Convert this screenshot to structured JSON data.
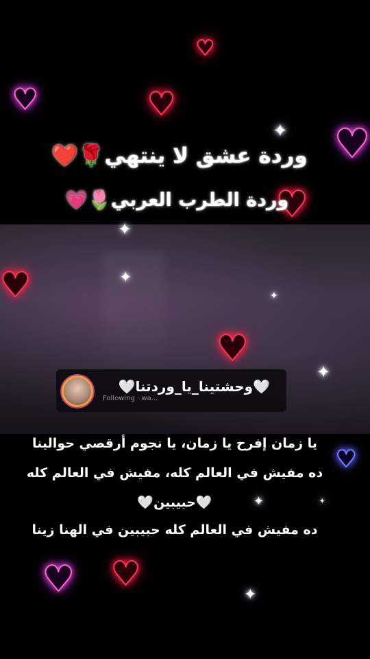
{
  "title": {
    "line1_text": "وردة عشق لا ينتهي",
    "line1_emojis": "🌹❤️",
    "line2_text": "وردة الطرب العربي",
    "line2_emojis": "🌷💗"
  },
  "comment": {
    "meta": "Following · wa...",
    "text": "🤍وحشتينا_يا_وردتنا🤍"
  },
  "lyrics": {
    "line1": "يا زمان إفرح يا زمان، يا نجوم أرقصي حوالينا",
    "line2": "ده مفيش في العالم كله، مفيش في العالم كله",
    "line3": "🤍حبيبين🤍",
    "line4": "ده مفيش في العالم كله حبيبين في الهنا زينا"
  },
  "decorations": {
    "heart_glyph": "♥",
    "sparkle_glyph": "✦",
    "colors": {
      "red": "#ff3355",
      "pink": "#ff66d0",
      "blue": "#6f7dff"
    }
  }
}
